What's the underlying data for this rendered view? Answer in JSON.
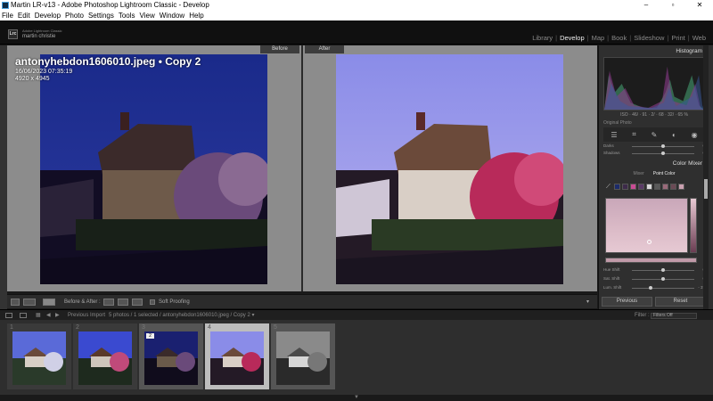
{
  "window": {
    "title": "Martin LR-v13 - Adobe Photoshop Lightroom Classic - Develop",
    "controls": [
      "–",
      "▫",
      "✕"
    ]
  },
  "menu": [
    "File",
    "Edit",
    "Develop",
    "Photo",
    "Settings",
    "Tools",
    "View",
    "Window",
    "Help"
  ],
  "identity": {
    "badge": "Lrc",
    "line1": "Adobe Lightroom Classic",
    "line2": "martin christie"
  },
  "modules": [
    {
      "label": "Library",
      "active": false
    },
    {
      "label": "Develop",
      "active": true
    },
    {
      "label": "Map",
      "active": false
    },
    {
      "label": "Book",
      "active": false
    },
    {
      "label": "Slideshow",
      "active": false
    },
    {
      "label": "Print",
      "active": false
    },
    {
      "label": "Web",
      "active": false
    }
  ],
  "compare": {
    "before_label": "Before",
    "after_label": "After",
    "file_name": "antonyhebdon1606010.jpeg  •  Copy 2",
    "date": "16/06/2023 07:35:19",
    "dimensions": "4920 x 4945"
  },
  "toolbar": {
    "mode_label": "Before & After :",
    "soft_proofing": "Soft Proofing"
  },
  "right_panel": {
    "histogram_title": "Histogram",
    "exif": "ISO  ·  46/  ·  91  ·  2/  ·  68  ·  32/  ·  65 %",
    "original_photo": "Original Photo",
    "sliders_top": [
      {
        "label": "Darks",
        "value": "0",
        "pos": 0.5
      },
      {
        "label": "Shadows",
        "value": "0",
        "pos": 0.5
      }
    ],
    "color_mixer_title": "Color Mixer",
    "color_mixer_tabs": [
      {
        "label": "Mixer",
        "active": false
      },
      {
        "label": "Point Color",
        "active": true
      }
    ],
    "swatch_colors": [
      "#1c2b6a",
      "#3d2a4a",
      "#c94c94",
      "#5a3a66",
      "#d9d9d9",
      "#5a5a5a",
      "#9a6a7a",
      "#6b4a55",
      "#c9a0b0"
    ],
    "sliders_bottom": [
      {
        "label": "Hue Shift",
        "value": "0",
        "pos": 0.5
      },
      {
        "label": "Sat. Shift",
        "value": "0",
        "pos": 0.5
      },
      {
        "label": "Lum. Shift",
        "value": "- 37",
        "pos": 0.3
      }
    ],
    "previous_button": "Previous",
    "reset_button": "Reset"
  },
  "filmstrip_bar": {
    "breadcrumb": "Previous Import",
    "selection": "5 photos / 1 selected / antonyhebdon1606010.jpeg / Copy 2 ▾",
    "filter_label": "Filter :",
    "filter_value": "Filters Off"
  },
  "thumbnails": [
    {
      "num": "1",
      "variant": "normal"
    },
    {
      "num": "2",
      "variant": "normal"
    },
    {
      "num": "3",
      "variant": "dark",
      "badge": "2"
    },
    {
      "num": "4",
      "variant": "selected"
    },
    {
      "num": "5",
      "variant": "bw"
    }
  ],
  "bottom_arrow": "▼"
}
